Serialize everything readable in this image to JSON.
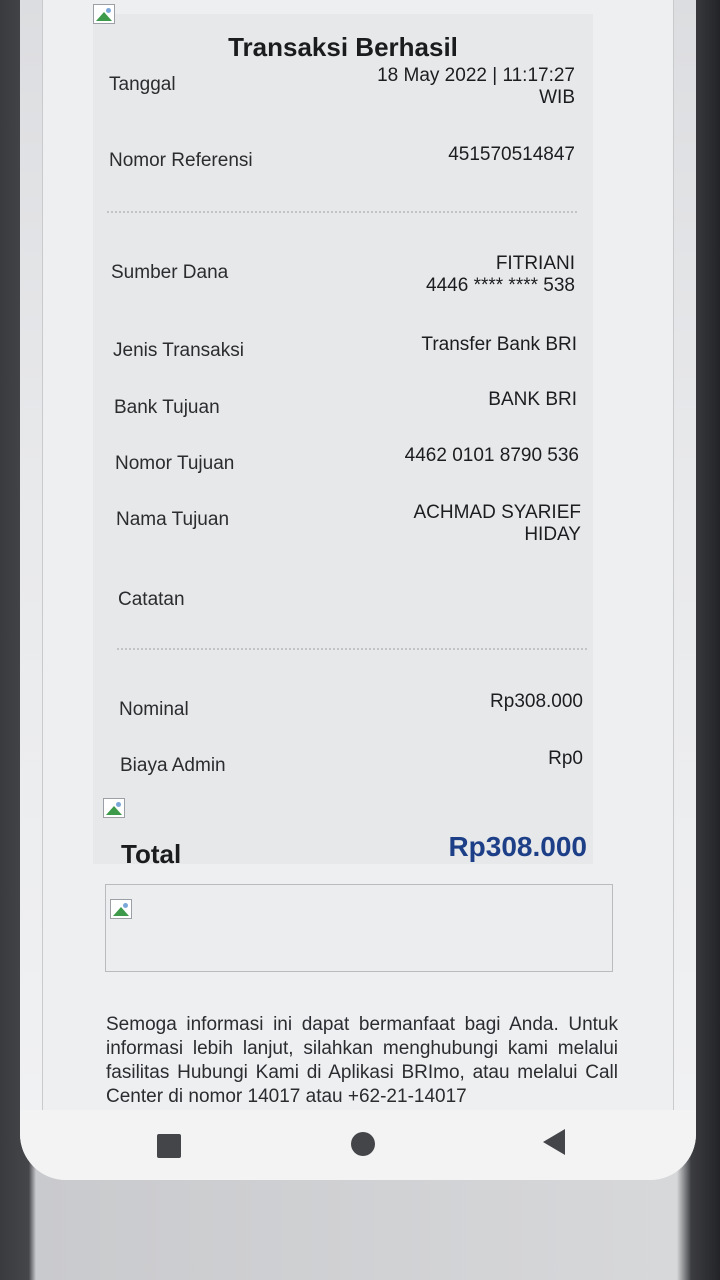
{
  "receipt": {
    "title": "Transaksi Berhasil",
    "tanggal_label": "Tanggal",
    "tanggal_value_line1": "18 May 2022 | 11:17:27",
    "tanggal_value_line2": "WIB",
    "referensi_label": "Nomor Referensi",
    "referensi_value": "451570514847",
    "sumber_label": "Sumber Dana",
    "sumber_name": "FITRIANI",
    "sumber_account": "4446 **** **** 538",
    "jenis_label": "Jenis Transaksi",
    "jenis_value": "Transfer Bank BRI",
    "bank_label": "Bank Tujuan",
    "bank_value": "BANK BRI",
    "nomor_tujuan_label": "Nomor Tujuan",
    "nomor_tujuan_value": "4462 0101 8790 536",
    "nama_tujuan_label": "Nama Tujuan",
    "nama_tujuan_line1": "ACHMAD SYARIEF",
    "nama_tujuan_line2": "HIDAY",
    "catatan_label": "Catatan",
    "catatan_value": "",
    "nominal_label": "Nominal",
    "nominal_value": "Rp308.000",
    "biaya_label": "Biaya Admin",
    "biaya_value": "Rp0",
    "total_label": "Total",
    "total_value": "Rp308.000",
    "total_color": "#1c3f87"
  },
  "footer": {
    "info_text": "Semoga informasi ini dapat bermanfaat bagi Anda. Untuk informasi lebih lanjut, silahkan menghubungi kami melalui fasilitas Hubungi Kami di Aplikasi BRImo, atau melalui Call Center di nomor 14017 atau +62-21-14017"
  },
  "navbar": {
    "recents_icon": "square-icon",
    "home_icon": "circle-icon",
    "back_icon": "triangle-back-icon"
  }
}
